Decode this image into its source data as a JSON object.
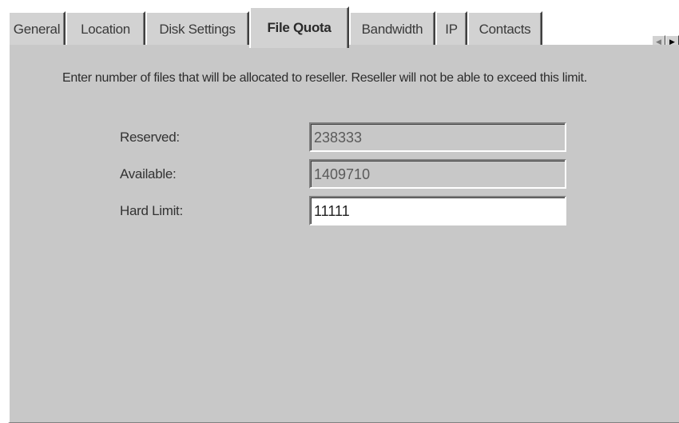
{
  "tabs": [
    {
      "label": "General",
      "active": false
    },
    {
      "label": "Location",
      "active": false
    },
    {
      "label": "Disk Settings",
      "active": false
    },
    {
      "label": "File Quota",
      "active": true
    },
    {
      "label": "Bandwidth",
      "active": false
    },
    {
      "label": "IP",
      "active": false
    },
    {
      "label": "Contacts",
      "active": false
    }
  ],
  "scroll_arrows": {
    "left": "◀",
    "right": "▶"
  },
  "file_quota": {
    "description": "Enter number of files that will be allocated to reseller. Reseller will not be able to exceed this limit.",
    "reserved": {
      "label": "Reserved:",
      "value": "238333"
    },
    "available": {
      "label": "Available:",
      "value": "1409710"
    },
    "hard_limit": {
      "label": "Hard Limit:",
      "value": "11111"
    }
  },
  "colors": {
    "panel_background": "#c8c8c8",
    "editable_field": "#ffffff"
  }
}
